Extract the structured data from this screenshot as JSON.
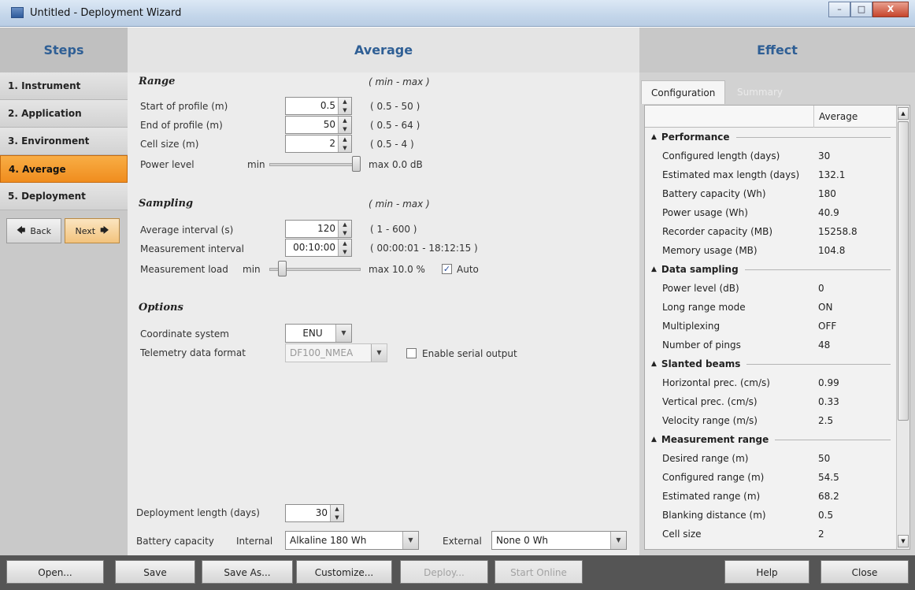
{
  "window": {
    "title": "Untitled - Deployment Wizard",
    "min": "–",
    "max": "□",
    "close": "X"
  },
  "steps": {
    "header": "Steps",
    "items": [
      {
        "label": "1. Instrument",
        "active": false
      },
      {
        "label": "2. Application",
        "active": false
      },
      {
        "label": "3. Environment",
        "active": false
      },
      {
        "label": "4. Average",
        "active": true
      },
      {
        "label": "5. Deployment",
        "active": false
      }
    ],
    "back": "Back",
    "next": "Next"
  },
  "average": {
    "header": "Average",
    "range": {
      "title": "Range",
      "hint": "( min - max )",
      "start_label": "Start of profile (m)",
      "start_value": "0.5",
      "start_range": "( 0.5 - 50 )",
      "end_label": "End of profile (m)",
      "end_value": "50",
      "end_range": "( 0.5 - 64 )",
      "cell_label": "Cell size (m)",
      "cell_value": "2",
      "cell_range": "( 0.5 - 4 )",
      "power_label": "Power level",
      "power_min": "min",
      "power_max": "max",
      "power_value": "0.0 dB",
      "power_fraction": 1.0
    },
    "sampling": {
      "title": "Sampling",
      "hint": "( min - max )",
      "avg_label": "Average interval (s)",
      "avg_value": "120",
      "avg_range": "( 1 - 600 )",
      "meas_label": "Measurement interval",
      "meas_value": "00:10:00",
      "meas_range": "( 00:00:01 - 18:12:15 )",
      "load_label": "Measurement load",
      "load_min": "min",
      "load_max": "max",
      "load_value": "10.0 %",
      "load_fraction": 0.1,
      "auto_label": "Auto",
      "auto_checked": true
    },
    "options": {
      "title": "Options",
      "coord_label": "Coordinate system",
      "coord_value": "ENU",
      "telemetry_label": "Telemetry data format",
      "telemetry_value": "DF100_NMEA",
      "serial_label": "Enable serial output",
      "serial_checked": false
    },
    "deployment_label": "Deployment length (days)",
    "deployment_value": "30",
    "battery_label": "Battery capacity",
    "internal_label": "Internal",
    "internal_value": "Alkaline 180 Wh",
    "external_label": "External",
    "external_value": "None 0 Wh"
  },
  "effect": {
    "header": "Effect",
    "tab_config": "Configuration",
    "tab_summary": "Summary",
    "column": "Average",
    "groups": [
      {
        "name": "Performance",
        "rows": [
          {
            "k": "Configured length (days)",
            "v": "30"
          },
          {
            "k": "Estimated max length (days)",
            "v": "132.1"
          },
          {
            "k": "Battery capacity (Wh)",
            "v": "180"
          },
          {
            "k": "Power usage (Wh)",
            "v": "40.9"
          },
          {
            "k": "Recorder capacity (MB)",
            "v": "15258.8"
          },
          {
            "k": "Memory usage (MB)",
            "v": "104.8"
          }
        ]
      },
      {
        "name": "Data sampling",
        "rows": [
          {
            "k": "Power level (dB)",
            "v": "0"
          },
          {
            "k": "Long range mode",
            "v": "ON"
          },
          {
            "k": "Multiplexing",
            "v": "OFF"
          },
          {
            "k": "Number of pings",
            "v": "48"
          }
        ]
      },
      {
        "name": "Slanted beams",
        "rows": [
          {
            "k": "Horizontal prec. (cm/s)",
            "v": "0.99"
          },
          {
            "k": "Vertical prec. (cm/s)",
            "v": "0.33"
          },
          {
            "k": "Velocity range (m/s)",
            "v": "2.5"
          }
        ]
      },
      {
        "name": "Measurement range",
        "rows": [
          {
            "k": "Desired range (m)",
            "v": "50"
          },
          {
            "k": "Configured range (m)",
            "v": "54.5"
          },
          {
            "k": "Estimated range (m)",
            "v": "68.2"
          },
          {
            "k": "Blanking distance (m)",
            "v": "0.5"
          },
          {
            "k": "Cell size",
            "v": "2"
          }
        ]
      }
    ]
  },
  "bottom": {
    "open": "Open...",
    "save": "Save",
    "save_as": "Save As...",
    "customize": "Customize...",
    "deploy": "Deploy...",
    "start_online": "Start Online",
    "help": "Help",
    "close": "Close"
  }
}
